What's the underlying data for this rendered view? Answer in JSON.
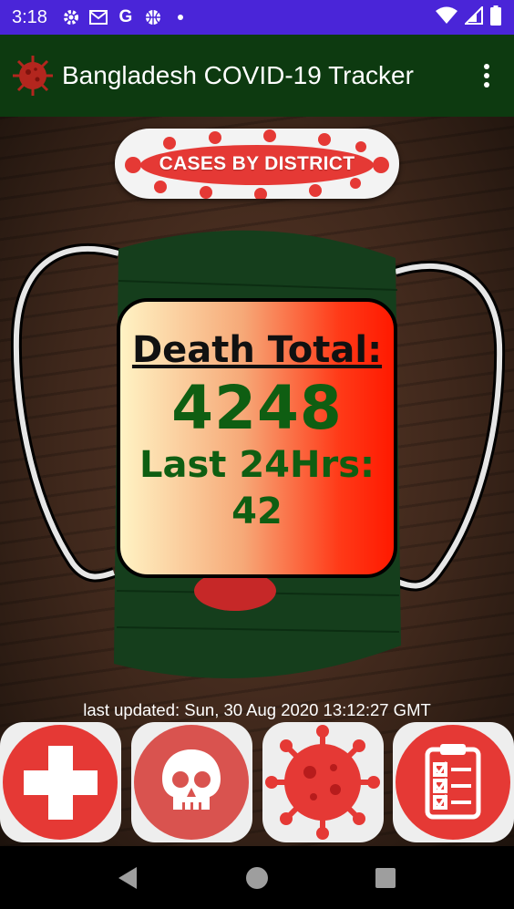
{
  "status_bar": {
    "time": "3:18",
    "icons": [
      "gear-icon",
      "gmail-icon",
      "google-icon",
      "basketball-icon",
      "dot-icon"
    ],
    "right_icons": [
      "wifi-icon",
      "signal-icon",
      "battery-icon"
    ]
  },
  "app_bar": {
    "title": "Bangladesh COVID-19 Tracker",
    "menu_icon": "more-vert-icon",
    "logo_icon": "virus-icon"
  },
  "district_button": {
    "label": "CASES BY DISTRICT"
  },
  "stats": {
    "death_heading": "Death Total:",
    "death_total": "4248",
    "last24_heading": "Last 24Hrs:",
    "last24_value": "42"
  },
  "last_updated": "last updated: Sun, 30 Aug 2020 13:12:27 GMT",
  "tiles": [
    {
      "icon": "medical-cross-icon"
    },
    {
      "icon": "skull-icon"
    },
    {
      "icon": "virus-icon"
    },
    {
      "icon": "clipboard-checklist-icon"
    }
  ],
  "colors": {
    "status_bar": "#4a25d8",
    "app_bar": "#0d3a10",
    "accent_red": "#e53935",
    "stat_green": "#0f5e12"
  },
  "nav": {
    "back_icon": "back-icon",
    "home_icon": "home-icon",
    "recents_icon": "recents-icon"
  }
}
